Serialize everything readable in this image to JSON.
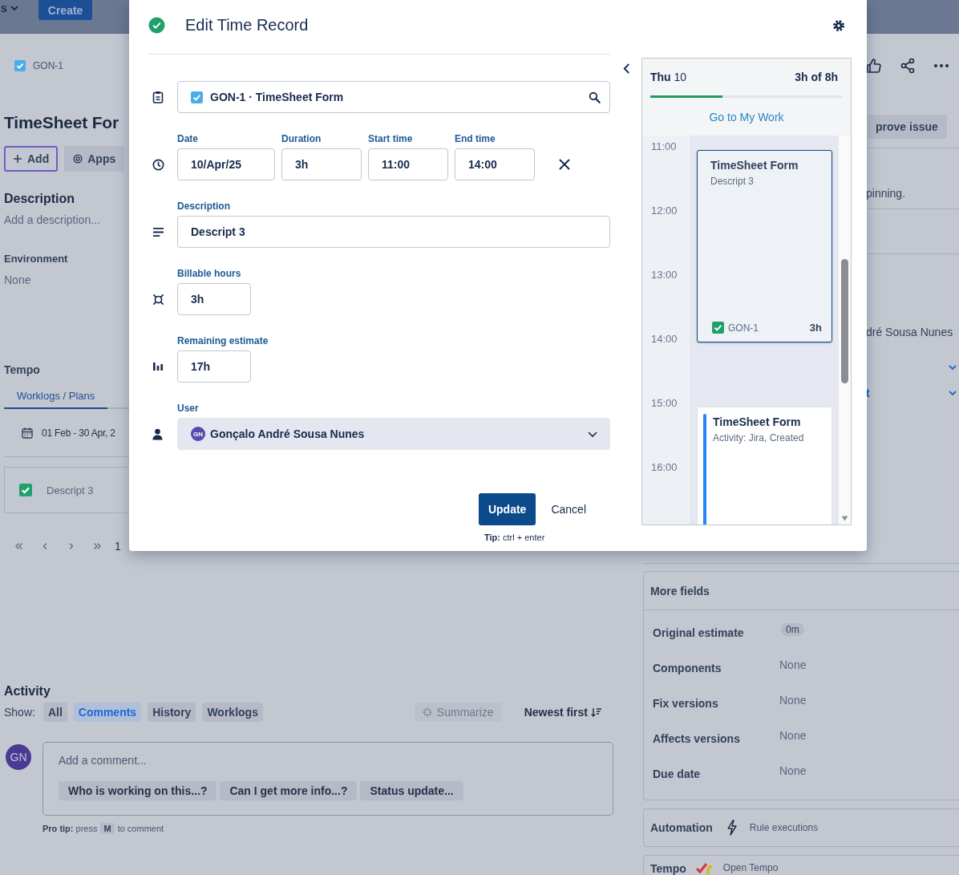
{
  "top_bar": {
    "menu_label": "s",
    "create_button": "Create"
  },
  "issue": {
    "breadcrumb": "GON-1",
    "title": "TimeSheet For",
    "actions": [
      {
        "label": "Add",
        "kind": "add",
        "focused": true
      },
      {
        "label": "Apps",
        "kind": "apps",
        "focused": false
      }
    ],
    "description": {
      "heading": "Description",
      "prompt": "Add a description..."
    },
    "environment": {
      "heading": "Environment",
      "value": "None"
    }
  },
  "tempo": {
    "heading": "Tempo",
    "tabs": [
      {
        "label": "Worklogs / Plans",
        "selected": true
      }
    ],
    "date_range": "01 Feb - 30 Apr, 2",
    "worklogs": [
      {
        "description": "Descript 3"
      }
    ],
    "page": "1"
  },
  "activity": {
    "heading": "Activity",
    "show_label": "Show:",
    "filters": [
      {
        "label": "All",
        "selected": false
      },
      {
        "label": "Comments",
        "selected": true
      },
      {
        "label": "History",
        "selected": false
      },
      {
        "label": "Worklogs",
        "selected": false
      }
    ],
    "summarize": {
      "label": "Summarize",
      "disabled": true
    },
    "sort": "Newest first",
    "comment": {
      "avatar": "GN",
      "placeholder": "Add a comment...",
      "suggestions": [
        "Who is working on this...?",
        "Can I get more info...?",
        "Status update..."
      ]
    },
    "pro_tip": {
      "text": "**Pro tip:** press",
      "key": "M",
      "suffix": "to comment"
    }
  },
  "side": {
    "approve_button": "prove issue",
    "note": "pinning.",
    "assignee": "dré Sousa Nunes",
    "expanders": [
      {
        "expanded": false
      },
      {
        "label": "t",
        "expanded": false
      }
    ],
    "more_fields": {
      "heading": "More fields",
      "fields": [
        {
          "label": "Original estimate",
          "value": "0m",
          "kind": "badge"
        },
        {
          "label": "Components",
          "value": "None",
          "kind": "text"
        },
        {
          "label": "Fix versions",
          "value": "None",
          "kind": "text"
        },
        {
          "label": "Affects versions",
          "value": "None",
          "kind": "text"
        },
        {
          "label": "Due date",
          "value": "None",
          "kind": "text"
        }
      ]
    },
    "automation": {
      "heading": "Automation",
      "link": "Rule executions"
    },
    "tempo_panel": {
      "heading": "Tempo",
      "link": "Open Tempo"
    }
  },
  "modal": {
    "title": "Edit Time Record",
    "issue": "GON-1 · TimeSheet Form",
    "time_fields": [
      {
        "label": "Date",
        "value": "10/Apr/25"
      },
      {
        "label": "Duration",
        "value": "3h"
      },
      {
        "label": "Start time",
        "value": "11:00"
      },
      {
        "label": "End time",
        "value": "14:00"
      }
    ],
    "description": {
      "label": "Description",
      "value": "Descript 3"
    },
    "billable": {
      "label": "Billable hours",
      "value": "3h"
    },
    "remaining": {
      "label": "Remaining estimate",
      "value": "17h"
    },
    "user": {
      "label": "User",
      "avatar": "GN",
      "name": "Gonçalo André Sousa Nunes"
    },
    "buttons": [
      {
        "label": "Update",
        "kind": "primary"
      },
      {
        "label": "Cancel",
        "kind": "subtle"
      }
    ],
    "tip": "**Tip:** ctrl + enter",
    "calendar": {
      "day_name": "Thu",
      "day": "10",
      "total": "3h of 8h",
      "level": 0.375,
      "link": "Go to My Work",
      "hours": [
        "11:00",
        "12:00",
        "13:00",
        "14:00",
        "15:00",
        "16:00"
      ],
      "events": [
        {
          "kind": "worklog",
          "selected": true,
          "title": "TimeSheet Form",
          "subtitle": "Descript 3",
          "issue_key": "GON-1",
          "duration": "3h"
        },
        {
          "kind": "activity",
          "selected": false,
          "title": "TimeSheet Form",
          "subtitle": "Activity: Jira, Created"
        }
      ]
    }
  }
}
